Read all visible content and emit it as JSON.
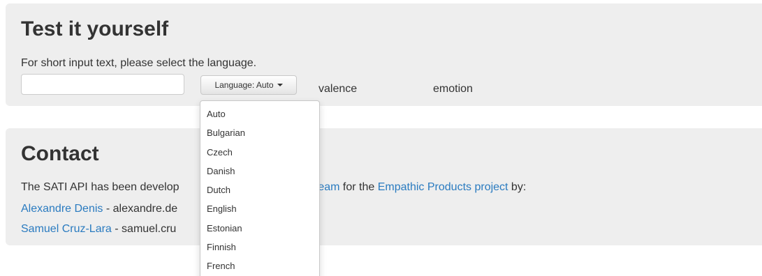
{
  "test_section": {
    "title": "Test it yourself",
    "instructions": "For short input text, please select the language.",
    "text_input": {
      "value": "",
      "placeholder": ""
    },
    "language_button": "Language: Auto",
    "valence_label": "valence",
    "emotion_label": "emotion"
  },
  "language_menu": {
    "items": [
      "Auto",
      "Bulgarian",
      "Czech",
      "Danish",
      "Dutch",
      "English",
      "Estonian",
      "Finnish",
      "French"
    ]
  },
  "contact_section": {
    "title": "Contact",
    "description": {
      "part1": "The SATI API has been develop",
      "team_link": "ALP team",
      "part2": " for the ",
      "project_link": "Empathic Products project",
      "part3": " by:"
    },
    "people": [
      {
        "name": "Alexandre Denis",
        "email_visible": " - alexandre.de"
      },
      {
        "name": "Samuel Cruz-Lara",
        "email_visible": " - samuel.cru"
      }
    ]
  },
  "colors": {
    "panel_background": "#eeeeee",
    "link": "#2a7bc0",
    "text": "#333333"
  }
}
